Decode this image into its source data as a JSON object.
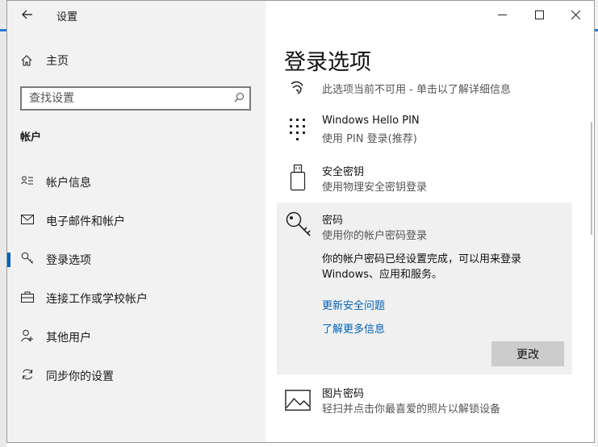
{
  "app": {
    "title": "设置",
    "back_icon": "back-arrow-icon"
  },
  "window_controls": {
    "minimize": "─",
    "maximize": "☐",
    "close": "✕"
  },
  "home": {
    "label": "主页",
    "icon": "home-icon"
  },
  "search": {
    "placeholder": "查找设置",
    "icon": "search-icon"
  },
  "section": {
    "title": "帐户"
  },
  "nav": [
    {
      "label": "帐户信息",
      "icon": "person-card-icon"
    },
    {
      "label": "电子邮件和帐户",
      "icon": "mail-icon"
    },
    {
      "label": "登录选项",
      "icon": "key-icon",
      "active": true
    },
    {
      "label": "连接工作或学校帐户",
      "icon": "briefcase-icon"
    },
    {
      "label": "其他用户",
      "icon": "person-add-icon"
    },
    {
      "label": "同步你的设置",
      "icon": "sync-icon"
    }
  ],
  "page": {
    "title": "登录选项"
  },
  "options": {
    "fingerprint": {
      "subtitle": "此选项当前不可用 - 单击以了解详细信息",
      "icon": "fingerprint-icon"
    },
    "pin": {
      "title": "Windows Hello PIN",
      "subtitle": "使用 PIN 登录(推荐)",
      "icon": "pin-keypad-icon"
    },
    "security_key": {
      "title": "安全密钥",
      "subtitle": "使用物理安全密钥登录",
      "icon": "usb-key-icon"
    },
    "password": {
      "title": "密码",
      "subtitle": "使用你的帐户密码登录",
      "description": "你的帐户密码已经设置完成，可以用来登录 Windows、应用和服务。",
      "link_update": "更新安全问题",
      "link_more": "了解更多信息",
      "button": "更改",
      "icon": "key-icon"
    },
    "picture_password": {
      "title": "图片密码",
      "subtitle": "轻扫并点击你最喜爱的照片以解锁设备",
      "icon": "picture-icon"
    }
  },
  "colors": {
    "accent": "#0063b1",
    "link": "#0062b3",
    "left_pane": "#f2f2f2",
    "panel": "#f0f0f0",
    "button": "#cccccc"
  }
}
